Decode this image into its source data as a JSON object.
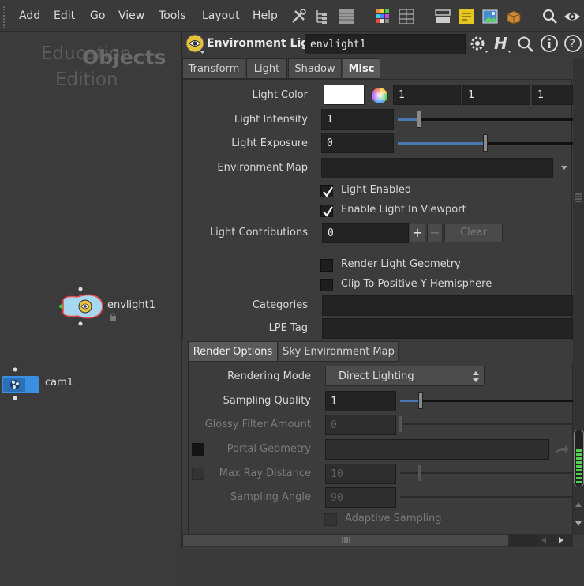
{
  "menubar": {
    "items": [
      "Add",
      "Edit",
      "Go",
      "View",
      "Tools",
      "Layout",
      "Help"
    ],
    "icons": [
      "tools-icon",
      "tree-icon",
      "list-icon",
      "color-grid-icon",
      "parm-grid-icon",
      "network-layout-icon",
      "sticky-note-icon",
      "image-icon",
      "box-icon",
      "search-icon",
      "eye-icon"
    ]
  },
  "network": {
    "watermark_1": "Education",
    "watermark_2": "Edition",
    "context": "Objects",
    "nodes": [
      {
        "name": "envlight1"
      },
      {
        "name": "cam1"
      }
    ]
  },
  "params": {
    "node_type": "Environment Light",
    "node_name": "envlight1",
    "tabs": [
      "Transform",
      "Light",
      "Shadow",
      "Misc"
    ],
    "active_tab": "Misc",
    "light_color": {
      "label": "Light Color",
      "swatch": "#ffffff",
      "r": "1",
      "g": "1",
      "b": "1"
    },
    "light_intensity": {
      "label": "Light Intensity",
      "value": "1",
      "slider_fraction": 0.12
    },
    "light_exposure": {
      "label": "Light Exposure",
      "value": "0",
      "slider_fraction": 0.5
    },
    "environment_map": {
      "label": "Environment Map",
      "value": ""
    },
    "light_enabled": {
      "label": "Light Enabled",
      "checked": true
    },
    "enable_in_viewport": {
      "label": "Enable Light In Viewport",
      "checked": true
    },
    "light_contributions": {
      "label": "Light Contributions",
      "value": "0",
      "clear": "Clear"
    },
    "render_light_geometry": {
      "label": "Render Light Geometry",
      "checked": false
    },
    "clip_to_positive_y": {
      "label": "Clip To Positive Y Hemisphere",
      "checked": false
    },
    "categories": {
      "label": "Categories",
      "value": ""
    },
    "lpe_tag": {
      "label": "LPE Tag",
      "value": ""
    },
    "sub_tabs": [
      "Render Options",
      "Sky Environment Map"
    ],
    "rendering_mode": {
      "label": "Rendering Mode",
      "value": "Direct Lighting"
    },
    "sampling_quality": {
      "label": "Sampling Quality",
      "value": "1",
      "slider_fraction": 0.12
    },
    "glossy_filter_amount": {
      "label": "Glossy Filter Amount",
      "value": "0"
    },
    "portal_geometry": {
      "label": "Portal Geometry",
      "value": ""
    },
    "max_ray_distance": {
      "label": "Max Ray Distance",
      "value": "10"
    },
    "sampling_angle": {
      "label": "Sampling Angle",
      "value": "90"
    },
    "adaptive_sampling": {
      "label": "Adaptive Sampling",
      "checked": false
    }
  },
  "colors": {
    "accent_blue": "#4a78b0",
    "cam_blue": "#3b8fe0",
    "light_yellow": "#e8c23a"
  }
}
